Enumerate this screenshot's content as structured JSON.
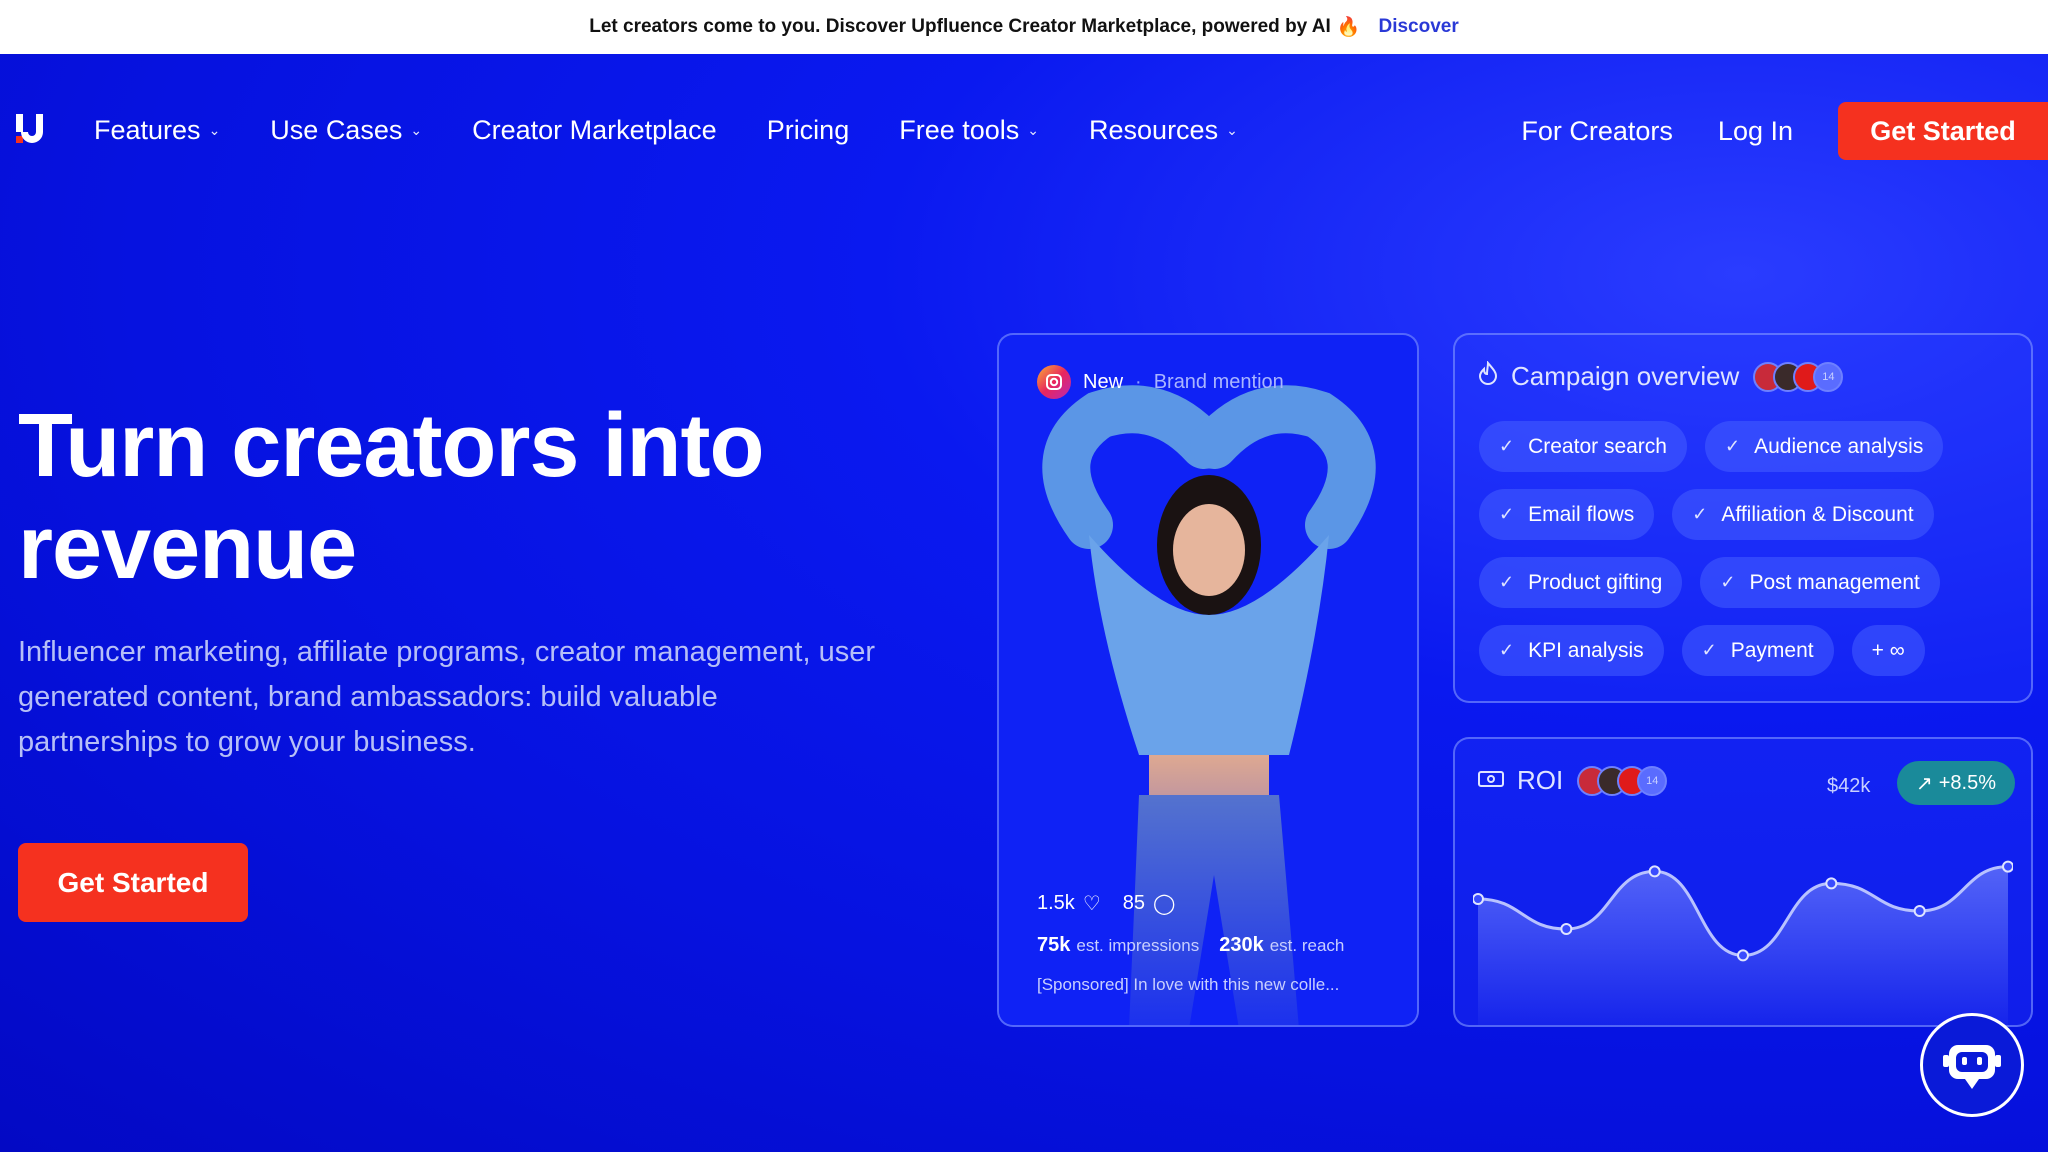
{
  "banner": {
    "text": "Let creators come to you. Discover Upfluence Creator Marketplace, powered by AI",
    "emoji": "🔥",
    "link": "Discover"
  },
  "nav": {
    "items": [
      {
        "label": "Features",
        "dropdown": true
      },
      {
        "label": "Use Cases",
        "dropdown": true
      },
      {
        "label": "Creator Marketplace",
        "dropdown": false
      },
      {
        "label": "Pricing",
        "dropdown": false
      },
      {
        "label": "Free tools",
        "dropdown": true
      },
      {
        "label": "Resources",
        "dropdown": true
      }
    ],
    "for_creators": "For Creators",
    "login": "Log In",
    "cta": "Get Started"
  },
  "hero": {
    "headline_line1": "Turn creators into",
    "headline_line2": "revenue",
    "subtext": "Influencer marketing, affiliate programs, creator management, user generated content, brand ambassadors: build valuable partnerships to grow your business.",
    "cta": "Get Started"
  },
  "post_card": {
    "status": "New",
    "separator": "·",
    "type": "Brand mention",
    "likes": "1.5k",
    "comments": "85",
    "impressions_value": "75k",
    "impressions_label": "est. impressions",
    "reach_value": "230k",
    "reach_label": "est. reach",
    "caption": "[Sponsored] In love with this new colle..."
  },
  "campaign": {
    "title": "Campaign overview",
    "avatar_count": "14",
    "chips": [
      [
        "Creator search",
        "Audience analysis"
      ],
      [
        "Email flows",
        "Affiliation & Discount"
      ],
      [
        "Product gifting",
        "Post management"
      ],
      [
        "KPI analysis",
        "Payment",
        "+ ∞"
      ]
    ]
  },
  "roi": {
    "title": "ROI",
    "avatar_count": "14",
    "amount": "$42k",
    "badge": "+8.5%",
    "series": [
      0.55,
      0.3,
      0.78,
      0.08,
      0.68,
      0.45,
      0.82
    ]
  },
  "colors": {
    "brand_blue": "#0a19f0",
    "cta_red": "#f5311f",
    "roi_badge": "#1a8a9a"
  }
}
